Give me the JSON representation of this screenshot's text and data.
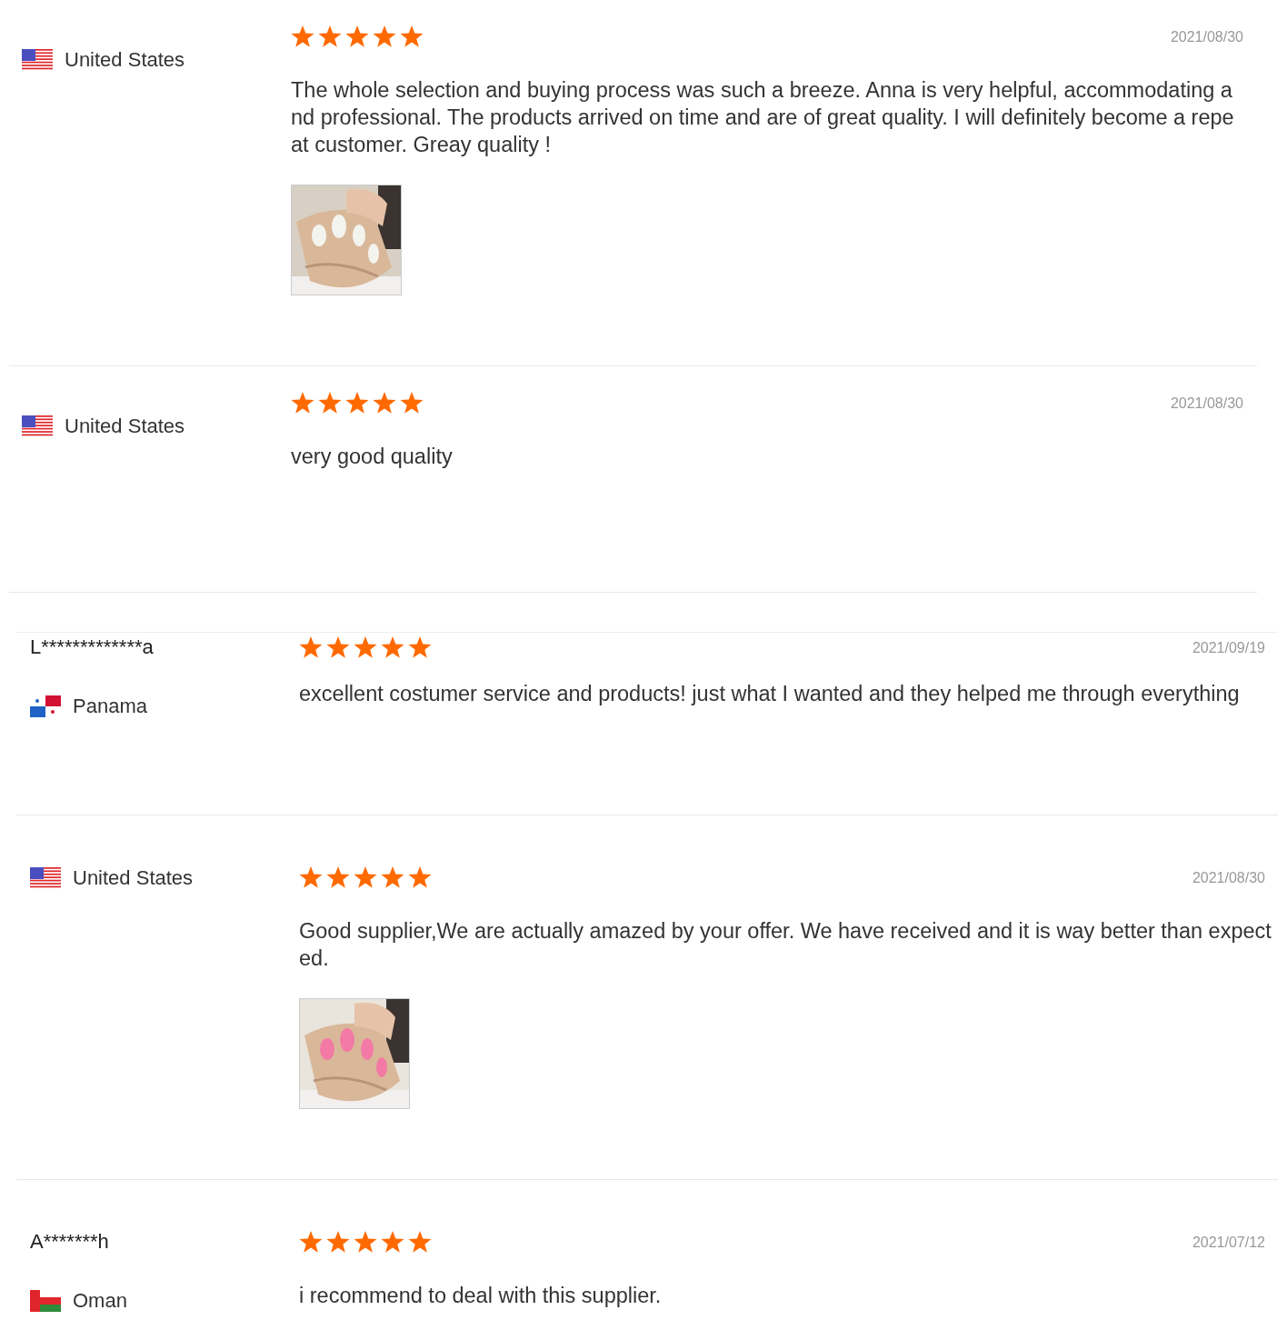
{
  "sections": [
    {
      "reviews": [
        {
          "country": "United States",
          "flag": {
            "kind": "us"
          },
          "stars": 5,
          "date": "2021/08/30",
          "text": "The whole selection and buying process was such a breeze. Anna is very helpful, accommodating and professional. The products arrived on time and are of great quality. I will definitely become a repeat customer. Greay quality !"
        },
        {
          "country": "United States",
          "flag": {
            "kind": "us"
          },
          "stars": 5,
          "date": "2021/08/30",
          "text": "very good quality"
        }
      ]
    },
    {
      "reviews": [
        {
          "name": "L*************a",
          "country": "Panama",
          "flag": {
            "kind": "pa"
          },
          "stars": 5,
          "date": "2021/09/19",
          "text": "excellent costumer service and products! just what I wanted and they helped me through everything"
        },
        {
          "country": "United States",
          "flag": {
            "kind": "us"
          },
          "stars": 5,
          "date": "2021/08/30",
          "text": "Good supplier,We are actually amazed by your offer. We have received and it is way better than expected."
        },
        {
          "name": "A*******h",
          "country": "Oman",
          "flag": {
            "kind": "om"
          },
          "stars": 5,
          "date": "2021/07/12",
          "text": "i recommend to deal with this supplier."
        }
      ]
    }
  ]
}
